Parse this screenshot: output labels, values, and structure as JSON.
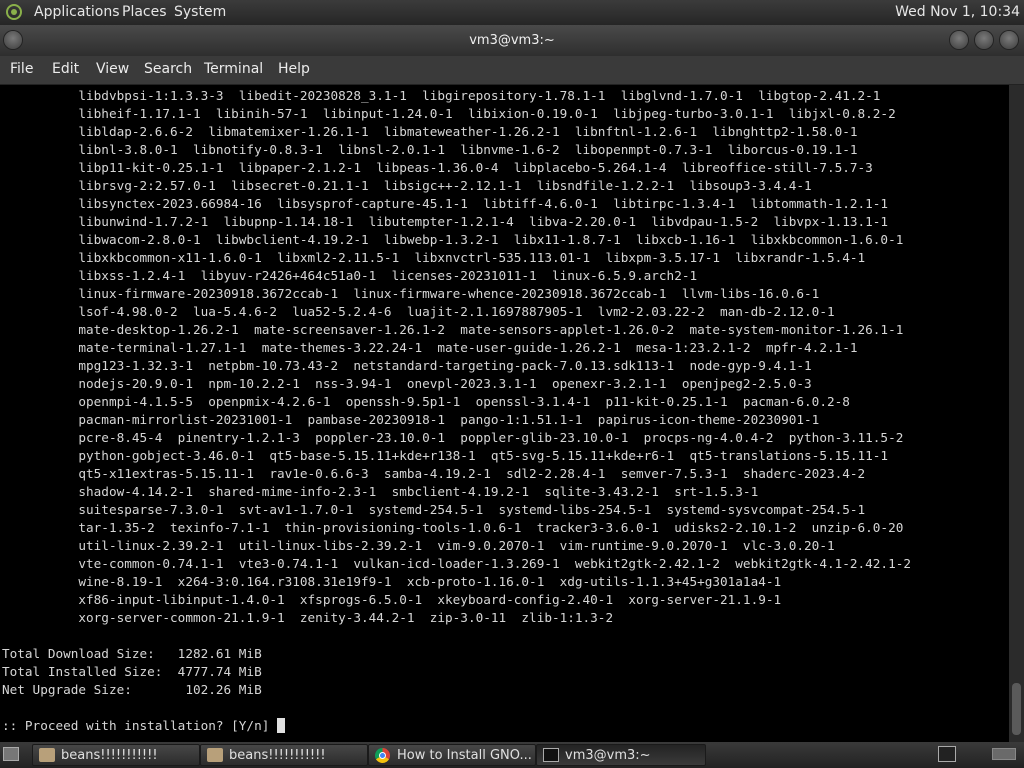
{
  "top_panel": {
    "menus": [
      "Applications",
      "Places",
      "System"
    ],
    "clock": "Wed Nov 1, 10:34"
  },
  "window": {
    "title": "vm3@vm3:~",
    "menu": [
      "File",
      "Edit",
      "View",
      "Search",
      "Terminal",
      "Help"
    ]
  },
  "terminal": {
    "lines": [
      "          libdvbpsi-1:1.3.3-3  libedit-20230828_3.1-1  libgirepository-1.78.1-1  libglvnd-1.7.0-1  libgtop-2.41.2-1",
      "          libheif-1.17.1-1  libinih-57-1  libinput-1.24.0-1  libixion-0.19.0-1  libjpeg-turbo-3.0.1-1  libjxl-0.8.2-2",
      "          libldap-2.6.6-2  libmatemixer-1.26.1-1  libmateweather-1.26.2-1  libnftnl-1.2.6-1  libnghttp2-1.58.0-1",
      "          libnl-3.8.0-1  libnotify-0.8.3-1  libnsl-2.0.1-1  libnvme-1.6-2  libopenmpt-0.7.3-1  liborcus-0.19.1-1",
      "          libp11-kit-0.25.1-1  libpaper-2.1.2-1  libpeas-1.36.0-4  libplacebo-5.264.1-4  libreoffice-still-7.5.7-3",
      "          librsvg-2:2.57.0-1  libsecret-0.21.1-1  libsigc++-2.12.1-1  libsndfile-1.2.2-1  libsoup3-3.4.4-1",
      "          libsynctex-2023.66984-16  libsysprof-capture-45.1-1  libtiff-4.6.0-1  libtirpc-1.3.4-1  libtommath-1.2.1-1",
      "          libunwind-1.7.2-1  libupnp-1.14.18-1  libutempter-1.2.1-4  libva-2.20.0-1  libvdpau-1.5-2  libvpx-1.13.1-1",
      "          libwacom-2.8.0-1  libwbclient-4.19.2-1  libwebp-1.3.2-1  libx11-1.8.7-1  libxcb-1.16-1  libxkbcommon-1.6.0-1",
      "          libxkbcommon-x11-1.6.0-1  libxml2-2.11.5-1  libxnvctrl-535.113.01-1  libxpm-3.5.17-1  libxrandr-1.5.4-1",
      "          libxss-1.2.4-1  libyuv-r2426+464c51a0-1  licenses-20231011-1  linux-6.5.9.arch2-1",
      "          linux-firmware-20230918.3672ccab-1  linux-firmware-whence-20230918.3672ccab-1  llvm-libs-16.0.6-1",
      "          lsof-4.98.0-2  lua-5.4.6-2  lua52-5.2.4-6  luajit-2.1.1697887905-1  lvm2-2.03.22-2  man-db-2.12.0-1",
      "          mate-desktop-1.26.2-1  mate-screensaver-1.26.1-2  mate-sensors-applet-1.26.0-2  mate-system-monitor-1.26.1-1",
      "          mate-terminal-1.27.1-1  mate-themes-3.22.24-1  mate-user-guide-1.26.2-1  mesa-1:23.2.1-2  mpfr-4.2.1-1",
      "          mpg123-1.32.3-1  netpbm-10.73.43-2  netstandard-targeting-pack-7.0.13.sdk113-1  node-gyp-9.4.1-1",
      "          nodejs-20.9.0-1  npm-10.2.2-1  nss-3.94-1  onevpl-2023.3.1-1  openexr-3.2.1-1  openjpeg2-2.5.0-3",
      "          openmpi-4.1.5-5  openpmix-4.2.6-1  openssh-9.5p1-1  openssl-3.1.4-1  p11-kit-0.25.1-1  pacman-6.0.2-8",
      "          pacman-mirrorlist-20231001-1  pambase-20230918-1  pango-1:1.51.1-1  papirus-icon-theme-20230901-1",
      "          pcre-8.45-4  pinentry-1.2.1-3  poppler-23.10.0-1  poppler-glib-23.10.0-1  procps-ng-4.0.4-2  python-3.11.5-2",
      "          python-gobject-3.46.0-1  qt5-base-5.15.11+kde+r138-1  qt5-svg-5.15.11+kde+r6-1  qt5-translations-5.15.11-1",
      "          qt5-x11extras-5.15.11-1  rav1e-0.6.6-3  samba-4.19.2-1  sdl2-2.28.4-1  semver-7.5.3-1  shaderc-2023.4-2",
      "          shadow-4.14.2-1  shared-mime-info-2.3-1  smbclient-4.19.2-1  sqlite-3.43.2-1  srt-1.5.3-1",
      "          suitesparse-7.3.0-1  svt-av1-1.7.0-1  systemd-254.5-1  systemd-libs-254.5-1  systemd-sysvcompat-254.5-1",
      "          tar-1.35-2  texinfo-7.1-1  thin-provisioning-tools-1.0.6-1  tracker3-3.6.0-1  udisks2-2.10.1-2  unzip-6.0-20",
      "          util-linux-2.39.2-1  util-linux-libs-2.39.2-1  vim-9.0.2070-1  vim-runtime-9.0.2070-1  vlc-3.0.20-1",
      "          vte-common-0.74.1-1  vte3-0.74.1-1  vulkan-icd-loader-1.3.269-1  webkit2gtk-2.42.1-2  webkit2gtk-4.1-2.42.1-2",
      "          wine-8.19-1  x264-3:0.164.r3108.31e19f9-1  xcb-proto-1.16.0-1  xdg-utils-1.1.3+45+g301a1a4-1",
      "          xf86-input-libinput-1.4.0-1  xfsprogs-6.5.0-1  xkeyboard-config-2.40-1  xorg-server-21.1.9-1",
      "          xorg-server-common-21.1.9-1  zenity-3.44.2-1  zip-3.0-11  zlib-1:1.3-2",
      "",
      "Total Download Size:   1282.61 MiB",
      "Total Installed Size:  4777.74 MiB",
      "Net Upgrade Size:       102.26 MiB",
      "",
      ":: Proceed with installation? [Y/n] "
    ]
  },
  "taskbar": {
    "tasks": [
      {
        "label": "beans!!!!!!!!!!!",
        "icon": "folder-icon"
      },
      {
        "label": "beans!!!!!!!!!!!",
        "icon": "folder-icon"
      },
      {
        "label": "How to Install GNO...",
        "icon": "chrome-icon"
      },
      {
        "label": "vm3@vm3:~",
        "icon": "terminal-icon"
      }
    ]
  }
}
